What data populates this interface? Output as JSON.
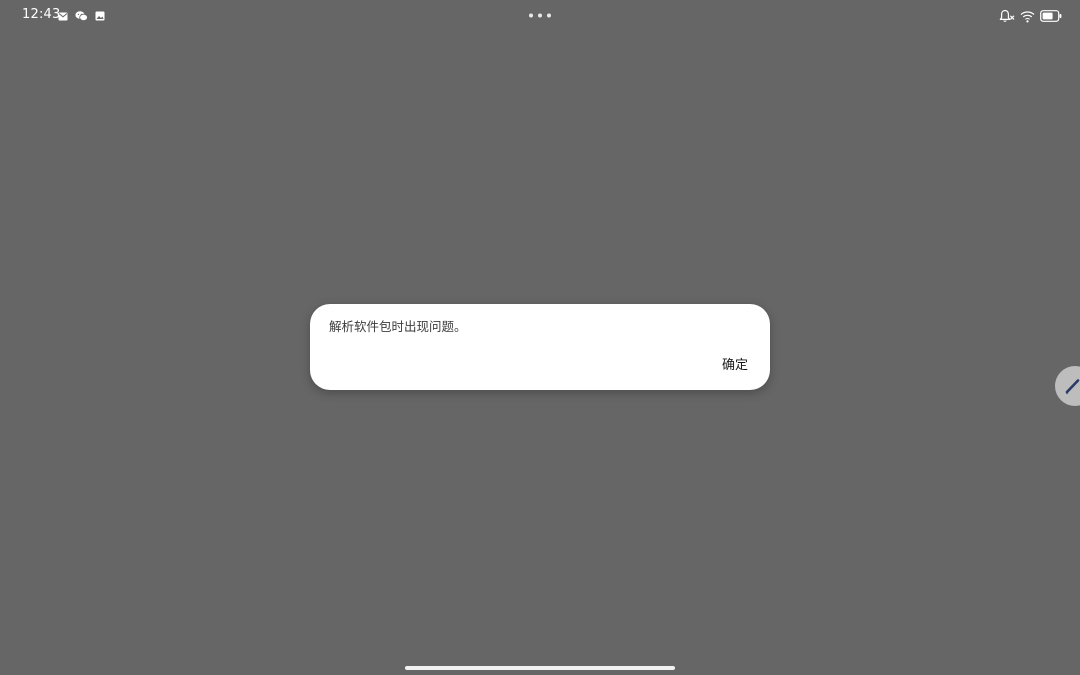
{
  "status_bar": {
    "time": "12:43",
    "notification_icons": [
      "mail-icon",
      "wechat-icon",
      "gallery-icon"
    ],
    "system_icons": [
      "bell-muted-icon",
      "wifi-icon",
      "battery-icon"
    ],
    "center_icon": "more-dots-icon"
  },
  "dialog": {
    "message": "解析软件包时出现问题。",
    "confirm_label": "确定"
  },
  "floating_button": {
    "icon": "pen-icon"
  },
  "colors": {
    "background": "#666666",
    "dialog_background": "#ffffff",
    "pen_accent": "#2b3a67"
  }
}
